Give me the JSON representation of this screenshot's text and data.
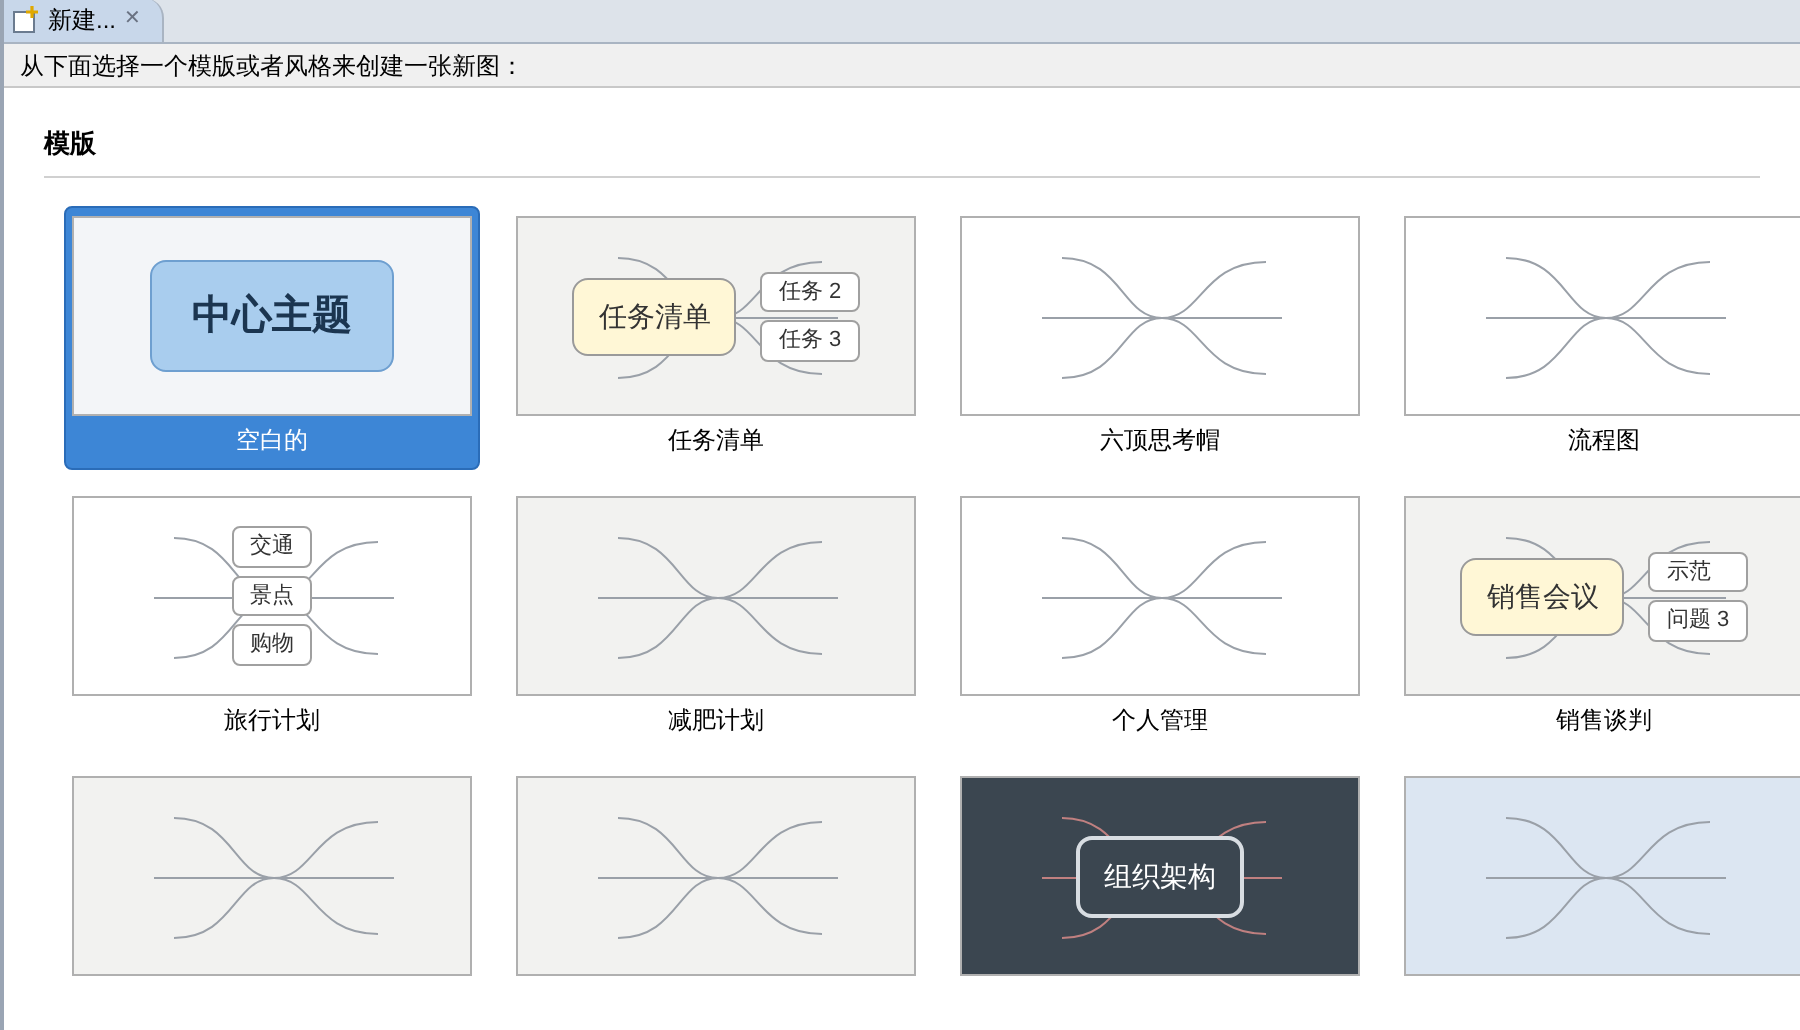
{
  "tab": {
    "title": "新建...",
    "close": "✕",
    "selected": true
  },
  "instruction": "从下面选择一个模版或者风格来创建一张新图：",
  "section_title": "模版",
  "templates": [
    {
      "label": "空白的",
      "selected": true,
      "kind": "blank",
      "nodes": [
        {
          "kind": "central",
          "text": "中心主题"
        }
      ]
    },
    {
      "label": "任务清单",
      "selected": false,
      "kind": "light",
      "nodes": [
        {
          "kind": "central",
          "text": "任务清单"
        },
        {
          "kind": "topic",
          "text": "任务 2"
        },
        {
          "kind": "topic",
          "text": "任务 3"
        }
      ]
    },
    {
      "label": "六顶思考帽",
      "selected": false,
      "kind": "white"
    },
    {
      "label": "流程图",
      "selected": false,
      "kind": "white"
    },
    {
      "label": "旅行计划",
      "selected": false,
      "kind": "white",
      "nodes": [
        {
          "kind": "topic",
          "text": "交通"
        },
        {
          "kind": "topic",
          "text": "景点"
        },
        {
          "kind": "topic",
          "text": "购物"
        }
      ]
    },
    {
      "label": "减肥计划",
      "selected": false,
      "kind": "light"
    },
    {
      "label": "个人管理",
      "selected": false,
      "kind": "white"
    },
    {
      "label": "销售谈判",
      "selected": false,
      "kind": "light",
      "nodes": [
        {
          "kind": "central",
          "text": "销售会议"
        },
        {
          "kind": "topic",
          "text": "示范"
        },
        {
          "kind": "topic",
          "text": "问题 3"
        }
      ]
    },
    {
      "selected": false,
      "kind": "light"
    },
    {
      "selected": false,
      "kind": "light"
    },
    {
      "selected": false,
      "kind": "dark",
      "nodes": [
        {
          "kind": "central",
          "text": "组织架构"
        }
      ]
    },
    {
      "selected": false,
      "kind": "blue"
    }
  ]
}
